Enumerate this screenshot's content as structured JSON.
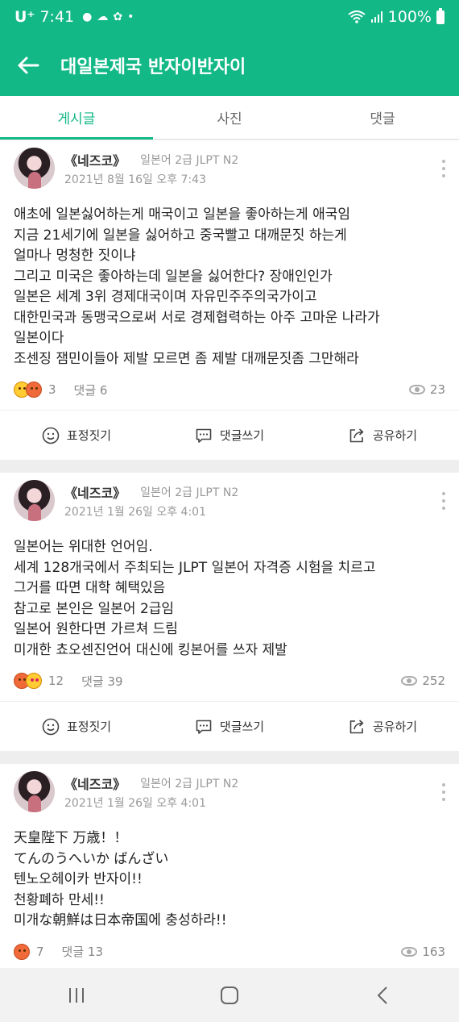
{
  "status_bar": {
    "carrier": "U⁺",
    "time": "7:41",
    "battery": "100%"
  },
  "app_bar": {
    "title": "대일본제국 반자이반자이"
  },
  "tabs": [
    {
      "label": "게시글",
      "active": true
    },
    {
      "label": "사진",
      "active": false
    },
    {
      "label": "댓글",
      "active": false
    }
  ],
  "actions": {
    "react": "표정짓기",
    "comment": "댓글쓰기",
    "share": "공유하기"
  },
  "posts": [
    {
      "author": "《네즈코》",
      "level": "일본어 2급 JLPT N2",
      "date": "2021년 8월 16일 오후 7:43",
      "lines": [
        "애초에 일본싫어하는게 매국이고 일본을 좋아하는게 애국임",
        "지금 21세기에 일본을 싫어하고 중국빨고 대깨문짓 하는게",
        "얼마나 멍청한 짓이냐",
        "그리고 미국은 좋아하는데 일본을 싫어한다? 장애인인가",
        "일본은 세계 3위 경제대국이며 자유민주주의국가이고",
        "대한민국과 동맹국으로써 서로 경제협력하는 아주 고마운 나라가",
        "일본이다",
        "조센징 잼민이들아 제발 모르면 좀 제발 대깨문짓좀 그만해라"
      ],
      "reaction_count": "3",
      "comments": "댓글 6",
      "views": "23"
    },
    {
      "author": "《네즈코》",
      "level": "일본어 2급 JLPT N2",
      "date": "2021년 1월 26일 오후 4:01",
      "lines": [
        "일본어는 위대한 언어임.",
        "세계 128개국에서 주최되는 JLPT 일본어 자격증 시험을 치르고",
        "그거를 따면 대학 혜택있음",
        "참고로 본인은 일본어 2급임",
        "일본어 원한다면 가르쳐 드림",
        "미개한 쵸오센진언어 대신에 킹본어를 쓰자 제발"
      ],
      "reaction_count": "12",
      "comments": "댓글 39",
      "views": "252"
    },
    {
      "author": "《네즈코》",
      "level": "일본어 2급 JLPT N2",
      "date": "2021년 1월 26일 오후 4:01",
      "lines": [
        "天皇陛下 万歳！！",
        "てんのうへいか ばんざい",
        "텐노오헤이카 반자이!!",
        "천황폐하 만세!!",
        "미개な朝鮮は日本帝国에 충성하라!!"
      ],
      "reaction_count": "7",
      "comments": "댓글 13",
      "views": "163"
    }
  ]
}
